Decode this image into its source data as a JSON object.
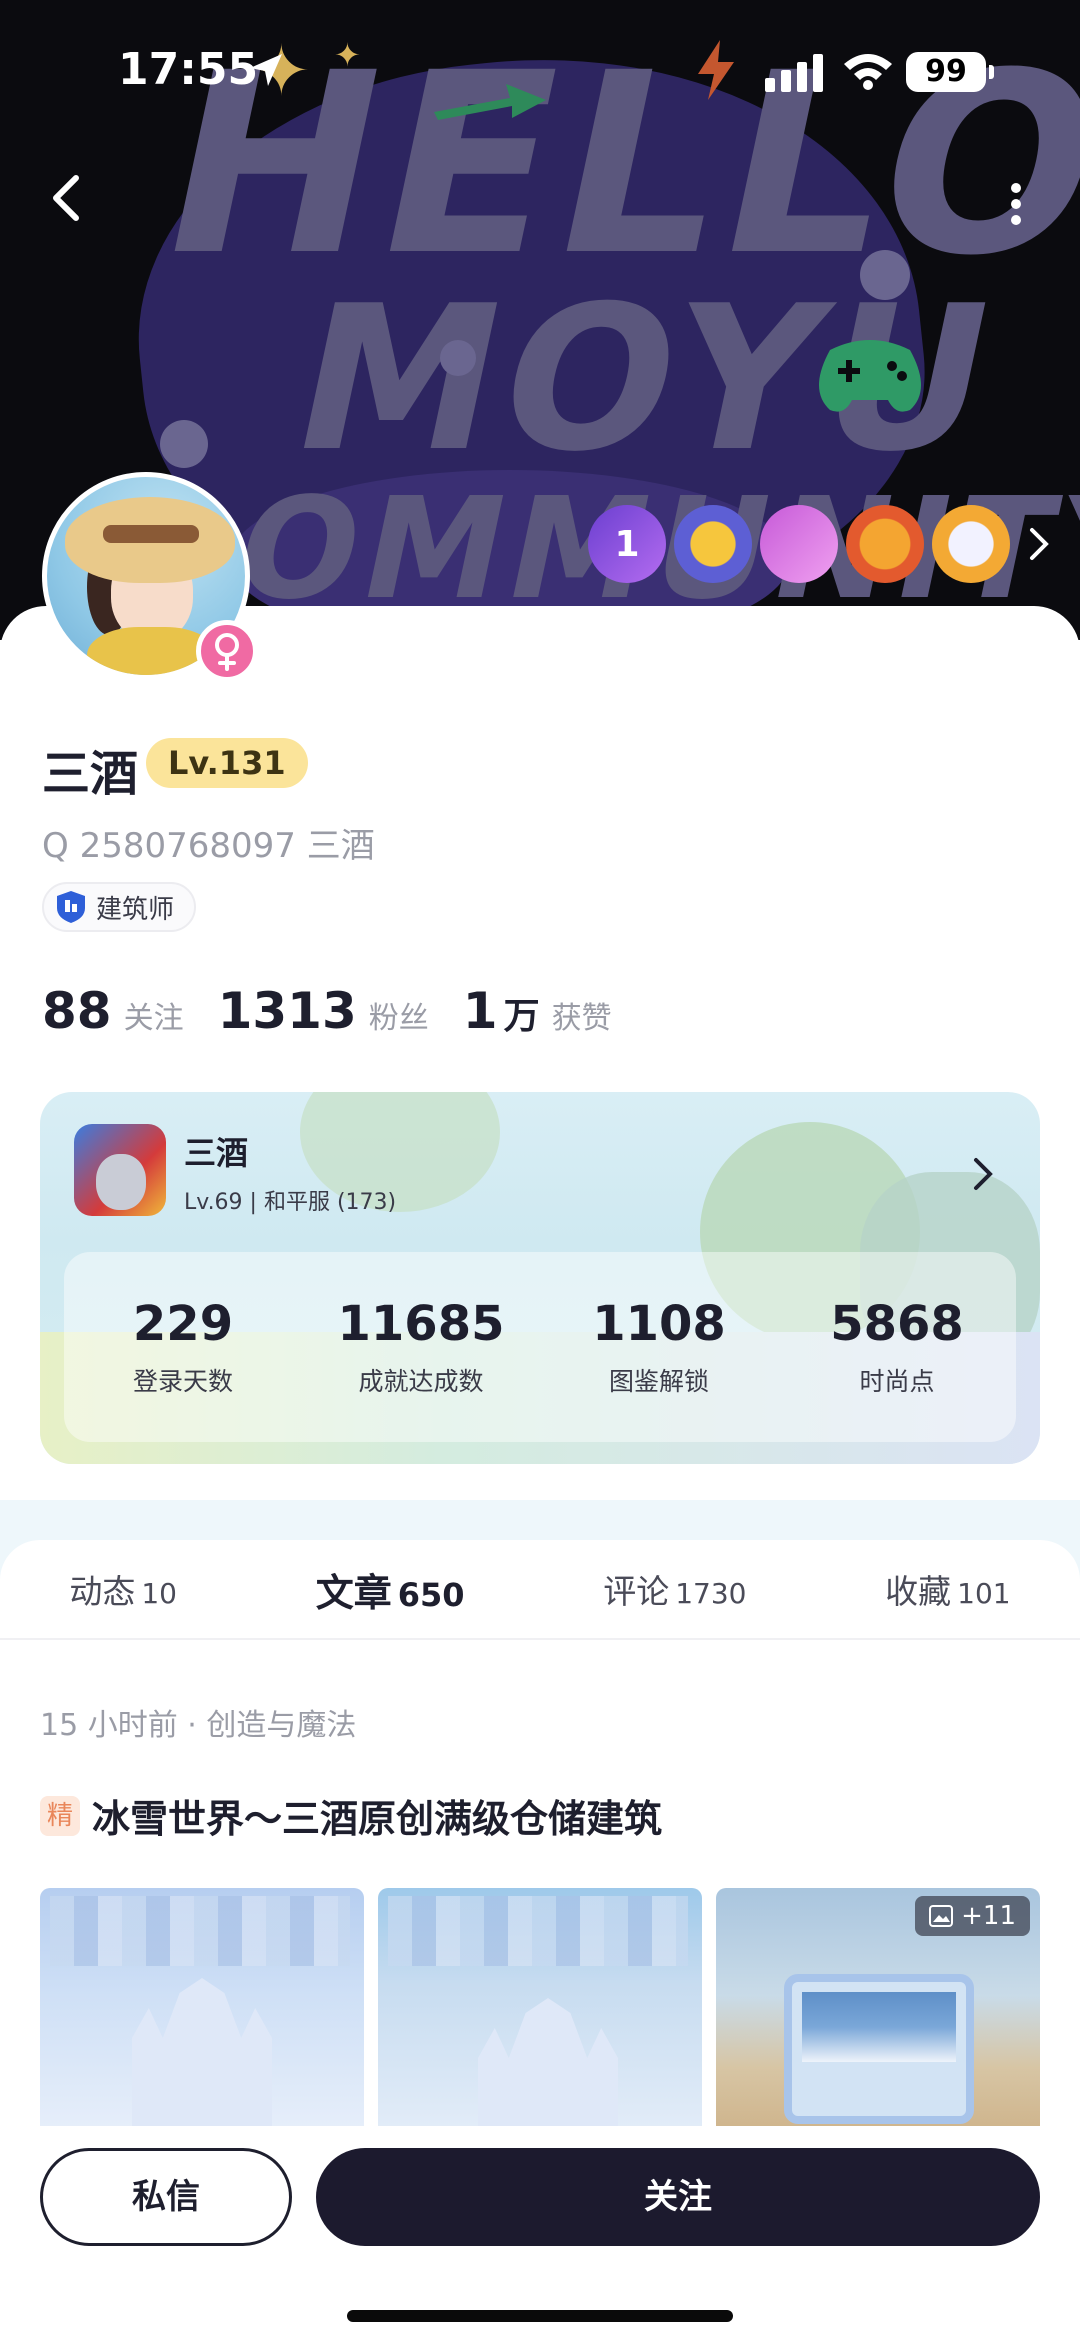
{
  "status_bar": {
    "time": "17:55",
    "battery": "99"
  },
  "hero": {
    "line1": "HELLO.",
    "line2": "MOYU",
    "line3": "OMMUNITY"
  },
  "medals": [
    "1",
    "",
    "",
    "",
    ""
  ],
  "profile": {
    "username": "三酒",
    "level": "Lv.131",
    "qq_id": "Q 2580768097 三酒",
    "role": "建筑师"
  },
  "stats": {
    "following_count": "88",
    "following_label": "关注",
    "fans_count": "1313",
    "fans_label": "粉丝",
    "likes_count": "1",
    "likes_unit": "万",
    "likes_label": "获赞"
  },
  "game_card": {
    "name": "三酒",
    "subtitle": "Lv.69 | 和平服 (173)",
    "stats": [
      {
        "value": "229",
        "label": "登录天数"
      },
      {
        "value": "11685",
        "label": "成就达成数"
      },
      {
        "value": "1108",
        "label": "图鉴解锁"
      },
      {
        "value": "5868",
        "label": "时尚点"
      }
    ]
  },
  "tabs": [
    {
      "label": "动态",
      "count": "10"
    },
    {
      "label": "文章",
      "count": "650"
    },
    {
      "label": "评论",
      "count": "1730"
    },
    {
      "label": "收藏",
      "count": "101"
    }
  ],
  "post": {
    "meta": "15 小时前 · 创造与魔法",
    "badge": "精",
    "title": "冰雪世界～三酒原创满级仓储建筑",
    "image_count": "+11"
  },
  "actions": {
    "dm_label": "私信",
    "follow_label": "关注"
  }
}
